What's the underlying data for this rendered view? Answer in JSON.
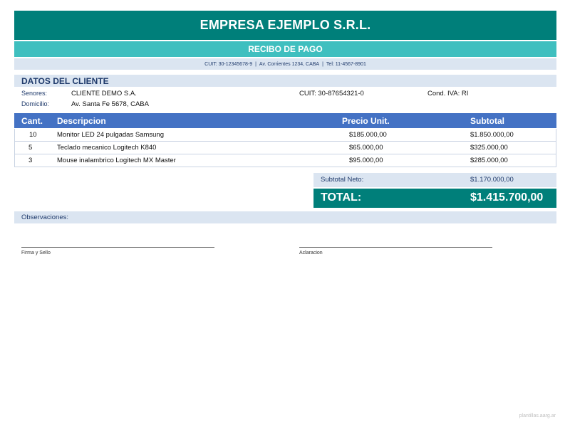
{
  "company": {
    "name": "EMPRESA EJEMPLO S.R.L."
  },
  "document": {
    "title": "RECIBO DE PAGO"
  },
  "company_info": {
    "cuit": "CUIT: 30-12345678-9",
    "address": "Av. Corrientes 1234, CABA",
    "phone": "Tel: 11-4567-8901",
    "separator": "|"
  },
  "client": {
    "header": "DATOS DEL CLIENTE",
    "name_label": "Senores:",
    "name": "CLIENTE DEMO S.A.",
    "cuit": "CUIT: 30-87654321-0",
    "iva": "Cond. IVA: RI",
    "address_label": "Domicilio:",
    "address": "Av. Santa Fe 5678, CABA"
  },
  "table": {
    "headers": {
      "qty": "Cant.",
      "desc": "Descripcion",
      "unit": "Precio Unit.",
      "subtotal": "Subtotal"
    },
    "rows": [
      {
        "qty": "10",
        "desc": "Monitor LED 24 pulgadas Samsung",
        "unit": "$185.000,00",
        "subtotal": "$1.850.000,00"
      },
      {
        "qty": "5",
        "desc": "Teclado mecanico Logitech K840",
        "unit": "$65.000,00",
        "subtotal": "$325.000,00"
      },
      {
        "qty": "3",
        "desc": "Mouse inalambrico Logitech MX Master",
        "unit": "$95.000,00",
        "subtotal": "$285.000,00"
      }
    ]
  },
  "totals": {
    "subtotal_label": "Subtotal Neto:",
    "subtotal_value": "$1.170.000,00",
    "total_label": "TOTAL:",
    "total_value": "$1.415.700,00"
  },
  "observations": {
    "label": "Observaciones:"
  },
  "signature": {
    "left_label": "Firma y Sello",
    "right_label": "Aclaracion"
  },
  "footer": {
    "text": "plantillas.aarg.ar"
  }
}
